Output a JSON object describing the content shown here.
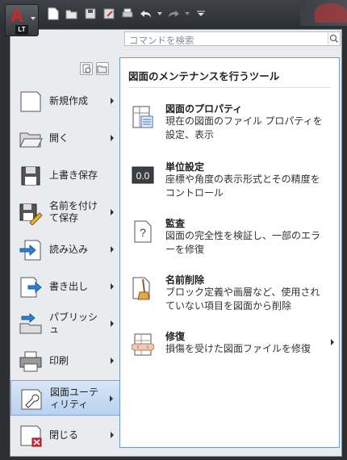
{
  "app": {
    "logo_letter": "A",
    "logo_badge": "LT"
  },
  "search": {
    "placeholder": "コマンドを検索"
  },
  "menu": {
    "items": [
      {
        "label": "新規作成",
        "icon": "new-document-icon"
      },
      {
        "label": "開く",
        "icon": "folder-open-icon"
      },
      {
        "label": "上書き保存",
        "icon": "save-icon"
      },
      {
        "label": "名前を付けて保存",
        "icon": "save-as-icon"
      },
      {
        "label": "読み込み",
        "icon": "import-icon"
      },
      {
        "label": "書き出し",
        "icon": "export-icon"
      },
      {
        "label": "パブリッシュ",
        "icon": "publish-icon"
      },
      {
        "label": "印刷",
        "icon": "printer-icon"
      },
      {
        "label": "図面ユーティリティ",
        "icon": "wrench-icon"
      },
      {
        "label": "閉じる",
        "icon": "close-document-icon"
      }
    ],
    "selected_index": 8
  },
  "panel": {
    "heading": "図面のメンテナンスを行うツール",
    "items": [
      {
        "title": "図面のプロパティ",
        "desc": "現在の図面のファイル プロパティを設定、表示",
        "icon": "drawing-properties-icon"
      },
      {
        "title": "単位設定",
        "desc": "座標や角度の表示形式とその精度をコントロール",
        "icon": "units-icon",
        "icon_text": "0.0"
      },
      {
        "title": "監査",
        "desc": "図面の完全性を検証し、一部のエラーを修復",
        "icon": "audit-icon",
        "icon_text": "?"
      },
      {
        "title": "名前削除",
        "desc": "ブロック定義や画層など、使用されていない項目を図面から削除",
        "icon": "purge-icon"
      },
      {
        "title": "修復",
        "desc": "損傷を受けた図面ファイルを修復",
        "icon": "recover-icon"
      }
    ]
  }
}
